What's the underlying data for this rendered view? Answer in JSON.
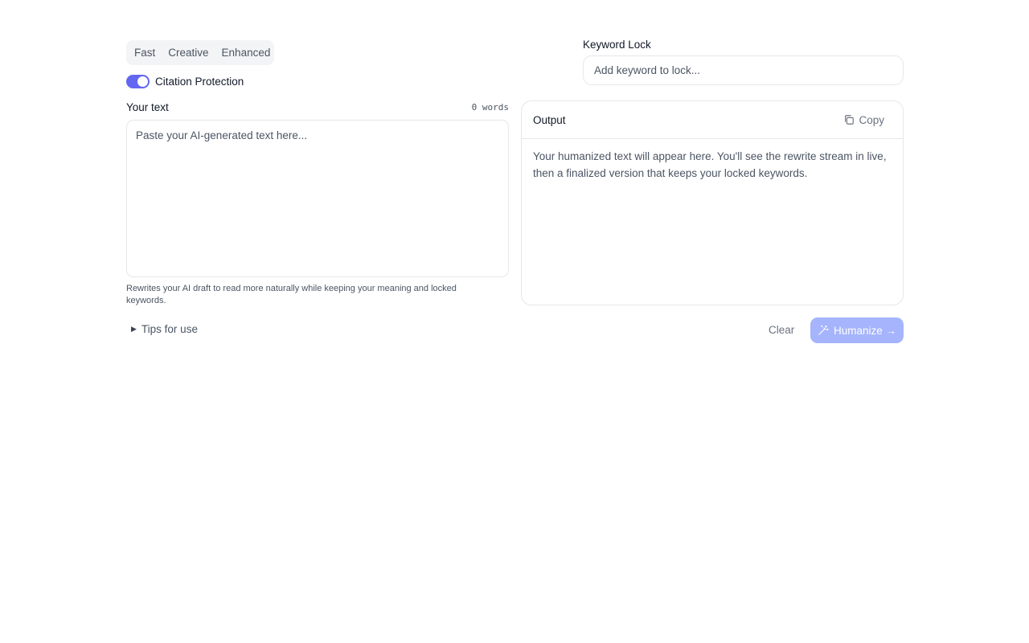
{
  "modes": [
    "Fast",
    "Creative",
    "Enhanced"
  ],
  "citation": {
    "label": "Citation Protection",
    "enabled": true
  },
  "keyword_lock": {
    "label": "Keyword Lock",
    "placeholder": "Add keyword to lock..."
  },
  "input": {
    "label": "Your text",
    "word_count": "0 words",
    "placeholder": "Paste your AI-generated text here...",
    "helper": "Rewrites your AI draft to read more naturally while keeping your meaning and locked keywords."
  },
  "output": {
    "title": "Output",
    "copy_label": "Copy",
    "placeholder": "Your humanized text will appear here. You'll see the rewrite stream in live, then a finalized version that keeps your locked keywords."
  },
  "footer": {
    "tips_label": "Tips for use",
    "clear_label": "Clear",
    "humanize_label": "Humanize →"
  },
  "icons": {
    "copy": "copy-icon",
    "humanize": "magic-wand-icon",
    "tips": "triangle-right-icon"
  },
  "colors": {
    "accent": "#6366f1",
    "button_disabled": "#a5b4fc",
    "border": "#e5e7eb",
    "muted_text": "#4b5563"
  }
}
